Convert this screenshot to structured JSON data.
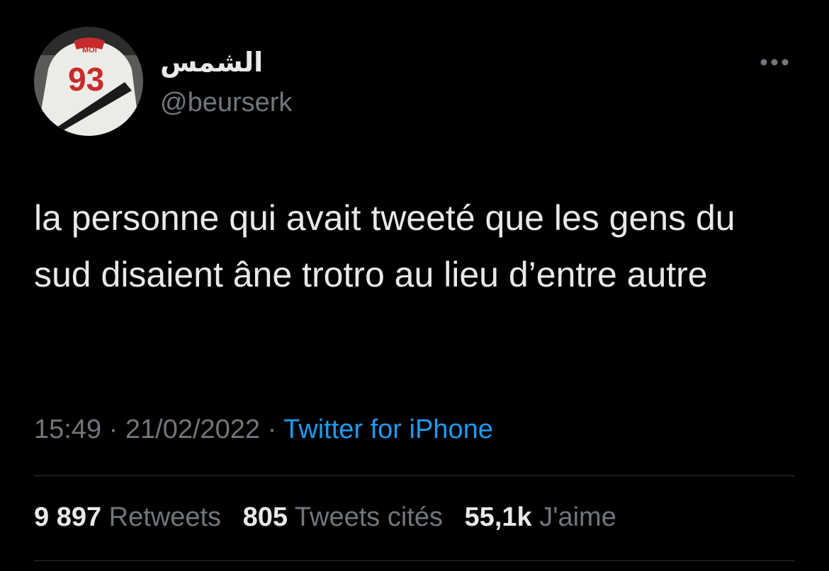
{
  "author": {
    "display_name": "الشمس",
    "handle": "@beurserk",
    "avatar_jersey_text": "MOI",
    "avatar_jersey_number": "93"
  },
  "tweet": {
    "text": "la personne qui avait tweeté que les gens du sud disaient âne trotro au lieu d’entre autre"
  },
  "meta": {
    "time": "15:49",
    "separator": "·",
    "date": "21/02/2022",
    "source": "Twitter for iPhone"
  },
  "stats": {
    "retweets_count": "9 897",
    "retweets_label": "Retweets",
    "quotes_count": "805",
    "quotes_label": "Tweets cités",
    "likes_count": "55,1k",
    "likes_label": "J'aime"
  },
  "icons": {
    "more": "more-horizontal-icon"
  },
  "colors": {
    "background": "#000000",
    "primary_text": "#e7e9ea",
    "secondary_text": "#71767b",
    "link": "#1d9bf0",
    "divider": "#2f3336"
  }
}
